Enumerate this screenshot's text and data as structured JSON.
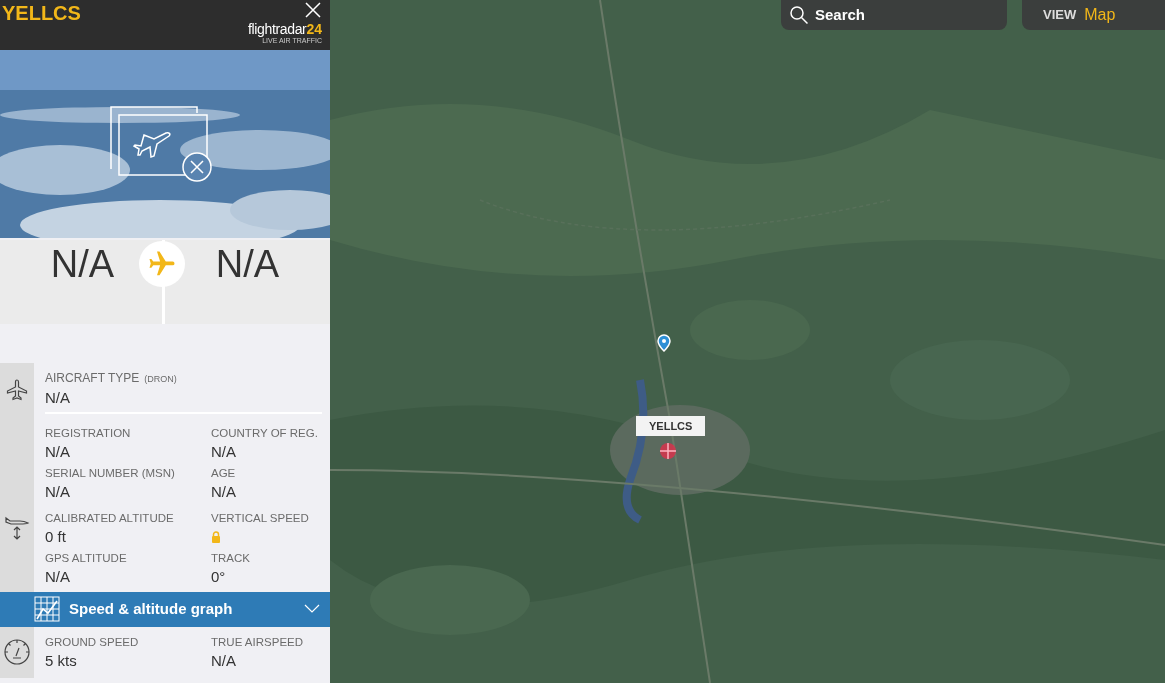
{
  "header": {
    "callsign": "YELLCS",
    "logo_name": "flightradar",
    "logo_number": "24",
    "logo_tagline": "LIVE AIR TRAFFIC"
  },
  "route": {
    "origin": "N/A",
    "destination": "N/A"
  },
  "aircraft_type": {
    "label": "AIRCRAFT TYPE",
    "code": "(DRON)",
    "value": "N/A"
  },
  "sections": [
    {
      "kind": "plane",
      "rows": [
        [
          {
            "label": "REGISTRATION",
            "kind": "text",
            "value": "N/A"
          },
          {
            "label": "COUNTRY OF REG.",
            "kind": "text",
            "value": "N/A"
          }
        ],
        [
          {
            "label": "SERIAL NUMBER (MSN)",
            "kind": "text",
            "value": "N/A"
          },
          {
            "label": "AGE",
            "kind": "text",
            "value": "N/A"
          }
        ]
      ]
    },
    {
      "kind": "altitude",
      "rows": [
        [
          {
            "label": "CALIBRATED ALTITUDE",
            "kind": "text",
            "value": "0 ft"
          },
          {
            "label": "VERTICAL SPEED",
            "kind": "locked"
          }
        ],
        [
          {
            "label": "GPS ALTITUDE",
            "kind": "text",
            "value": "N/A"
          },
          {
            "label": "TRACK",
            "kind": "text",
            "value": "0°"
          }
        ]
      ]
    }
  ],
  "graph_bar": {
    "label": "Speed & altitude graph",
    "expanded": false
  },
  "speed": {
    "kind": "gauge",
    "rows": [
      [
        {
          "label": "GROUND SPEED",
          "kind": "text",
          "value": "5 kts"
        },
        {
          "label": "TRUE AIRSPEED",
          "kind": "text",
          "value": "N/A"
        }
      ]
    ]
  },
  "map": {
    "search": "Search",
    "view_label": "VIEW",
    "view_value": "Map",
    "marker_label": "YELLCS"
  }
}
